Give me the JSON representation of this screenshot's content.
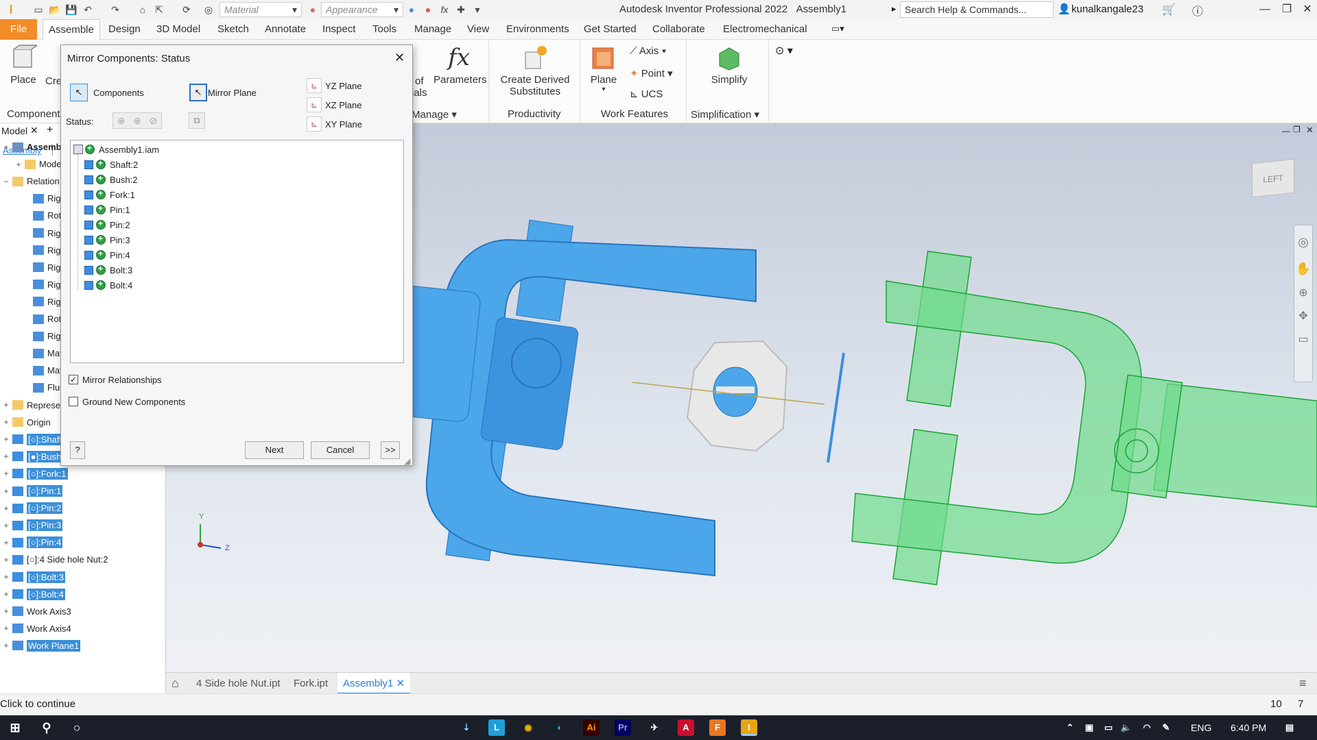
{
  "app": {
    "title": "Autodesk Inventor Professional 2022",
    "document": "Assembly1",
    "search_placeholder": "Search Help & Commands...",
    "user": "kunalkangale23",
    "material": "Material",
    "appearance": "Appearance"
  },
  "tabs": [
    "File",
    "Assemble",
    "Design",
    "3D Model",
    "Sketch",
    "Annotate",
    "Inspect",
    "Tools",
    "Manage",
    "View",
    "Environments",
    "Get Started",
    "Collaborate",
    "Electromechanical"
  ],
  "ribbon": {
    "place": "Place",
    "create": "Cre",
    "component_panel": "Component",
    "bom": "of",
    "bom2": "ials",
    "parameters": "Parameters",
    "manage_panel": "Manage",
    "create_derived_1": "Create Derived",
    "create_derived_2": "Substitutes",
    "productivity": "Productivity",
    "plane": "Plane",
    "axis": "Axis",
    "point": "Point",
    "ucs": "UCS",
    "work_features": "Work Features",
    "simplify": "Simplify",
    "simplification": "Simplification"
  },
  "browser": {
    "tab_model": "Model",
    "tab_assembly": "Assembly",
    "rows": [
      {
        "label": "Assembly",
        "bold": true,
        "hl": false
      },
      {
        "label": "Model S",
        "hl": false
      },
      {
        "label": "Relation",
        "hl": false
      },
      {
        "label": "Rigi",
        "hl": false
      },
      {
        "label": "Rota",
        "hl": false
      },
      {
        "label": "Rigi",
        "hl": false
      },
      {
        "label": "Rigi",
        "hl": false
      },
      {
        "label": "Rigi",
        "hl": false
      },
      {
        "label": "Rigi",
        "hl": false
      },
      {
        "label": "Rigi",
        "hl": false
      },
      {
        "label": "Rota",
        "hl": false
      },
      {
        "label": "Rigi",
        "hl": false
      },
      {
        "label": "Mate",
        "hl": false
      },
      {
        "label": "Mate",
        "hl": false
      },
      {
        "label": "Flus",
        "hl": false
      },
      {
        "label": "Represe",
        "hl": false
      },
      {
        "label": "Origin",
        "hl": false
      },
      {
        "label": "[○]:Shaft:2",
        "hl": true
      },
      {
        "label": "[●]:Bush:2",
        "hl": true
      },
      {
        "label": "[○]:Fork:1",
        "hl": true
      },
      {
        "label": "[○]:Pin:1",
        "hl": true
      },
      {
        "label": "[○]:Pin:2",
        "hl": true
      },
      {
        "label": "[○]:Pin:3",
        "hl": true
      },
      {
        "label": "[○]:Pin:4",
        "hl": true
      },
      {
        "label": "[○]:4 Side hole Nut:2",
        "hl": false
      },
      {
        "label": "[○]:Bolt:3",
        "hl": true
      },
      {
        "label": "[○]:Bolt:4",
        "hl": true
      },
      {
        "label": "Work Axis3",
        "hl": false
      },
      {
        "label": "Work Axis4",
        "hl": false
      },
      {
        "label": "Work Plane1",
        "hl": true
      }
    ]
  },
  "dialog": {
    "title": "Mirror Components: Status",
    "components": "Components",
    "mirror_plane": "Mirror Plane",
    "status": "Status:",
    "yz": "YZ Plane",
    "xz": "XZ Plane",
    "xy": "XY Plane",
    "root": "Assembly1.iam",
    "items": [
      "Shaft:2",
      "Bush:2",
      "Fork:1",
      "Pin:1",
      "Pin:2",
      "Pin:3",
      "Pin:4",
      "Bolt:3",
      "Bolt:4"
    ],
    "mirror_relationships": "Mirror Relationships",
    "mirror_relationships_checked": true,
    "ground_new": "Ground New Components",
    "ground_new_checked": false,
    "next": "Next",
    "cancel": "Cancel",
    "more": ">>"
  },
  "viewcube": "LEFT",
  "axes": {
    "y": "Y",
    "z": "Z"
  },
  "doctabs": [
    "4 Side hole Nut.ipt",
    "Fork.ipt",
    "Assembly1"
  ],
  "status": {
    "message": "Click to continue",
    "n1": "10",
    "n2": "7"
  },
  "taskbar": {
    "lang": "ENG",
    "time": "6:40 PM"
  },
  "colors": {
    "accent": "#f28c28",
    "blue_part": "#4ba6ea",
    "green_part": "#6fdc8c",
    "highlight": "#3b8fd8"
  }
}
